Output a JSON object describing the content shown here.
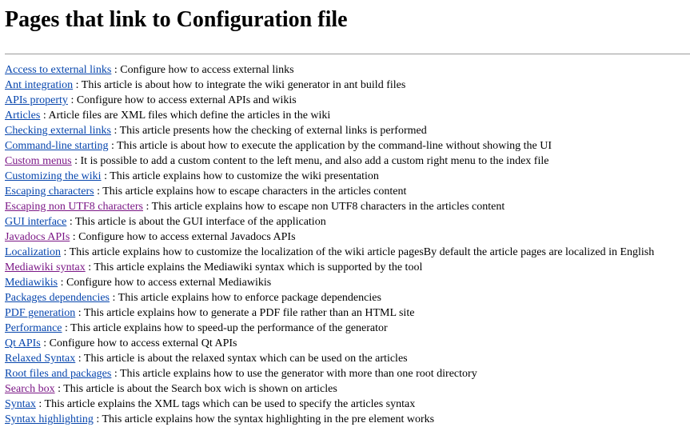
{
  "page_title": "Pages that link to Configuration file",
  "colors": {
    "link": "#0645ad",
    "visited_link": "#7b1786",
    "rule": "#9a9a9a"
  },
  "links": [
    {
      "title": "Access to external links",
      "description": "Configure how to access external links",
      "visited": false
    },
    {
      "title": "Ant integration",
      "description": "This article is about how to integrate the wiki generator in ant build files",
      "visited": false
    },
    {
      "title": "APIs property",
      "description": "Configure how to access external APIs and wikis",
      "visited": false
    },
    {
      "title": "Articles",
      "description": "Article files are XML files which define the articles in the wiki",
      "visited": false
    },
    {
      "title": "Checking external links",
      "description": "This article presents how the checking of external links is performed",
      "visited": false
    },
    {
      "title": "Command-line starting",
      "description": "This article is about how to execute the application by the command-line without showing the UI",
      "visited": false
    },
    {
      "title": "Custom menus",
      "description": "It is possible to add a custom content to the left menu, and also add a custom right menu to the index file",
      "visited": true
    },
    {
      "title": "Customizing the wiki",
      "description": "This article explains how to customize the wiki presentation",
      "visited": false
    },
    {
      "title": "Escaping characters",
      "description": "This article explains how to escape characters in the articles content",
      "visited": false
    },
    {
      "title": "Escaping non UTF8 characters",
      "description": "This article explains how to escape non UTF8 characters in the articles content",
      "visited": true
    },
    {
      "title": "GUI interface",
      "description": "This article is about the GUI interface of the application",
      "visited": false
    },
    {
      "title": "Javadocs APIs",
      "description": "Configure how to access external Javadocs APIs",
      "visited": true
    },
    {
      "title": "Localization",
      "description": "This article explains how to customize the localization of the wiki article pagesBy default the article pages are localized in English",
      "visited": false
    },
    {
      "title": "Mediawiki syntax",
      "description": "This article explains the Mediawiki syntax which is supported by the tool",
      "visited": true
    },
    {
      "title": "Mediawikis",
      "description": "Configure how to access external Mediawikis",
      "visited": false
    },
    {
      "title": "Packages dependencies",
      "description": "This article explains how to enforce package dependencies",
      "visited": false
    },
    {
      "title": "PDF generation",
      "description": "This article explains how to generate a PDF file rather than an HTML site",
      "visited": false
    },
    {
      "title": "Performance",
      "description": "This article explains how to speed-up the performance of the generator",
      "visited": false
    },
    {
      "title": "Qt APIs",
      "description": "Configure how to access external Qt APIs",
      "visited": false
    },
    {
      "title": "Relaxed Syntax",
      "description": "This article is about the relaxed syntax which can be used on the articles",
      "visited": false
    },
    {
      "title": "Root files and packages",
      "description": "This article explains how to use the generator with more than one root directory",
      "visited": false
    },
    {
      "title": "Search box",
      "description": "This article is about the Search box wich is shown on articles",
      "visited": true
    },
    {
      "title": "Syntax",
      "description": "This article explains the XML tags which can be used to specify the articles syntax",
      "visited": false
    },
    {
      "title": "Syntax highlighting",
      "description": "This article explains how the syntax highlighting in the pre element works",
      "visited": false
    }
  ]
}
